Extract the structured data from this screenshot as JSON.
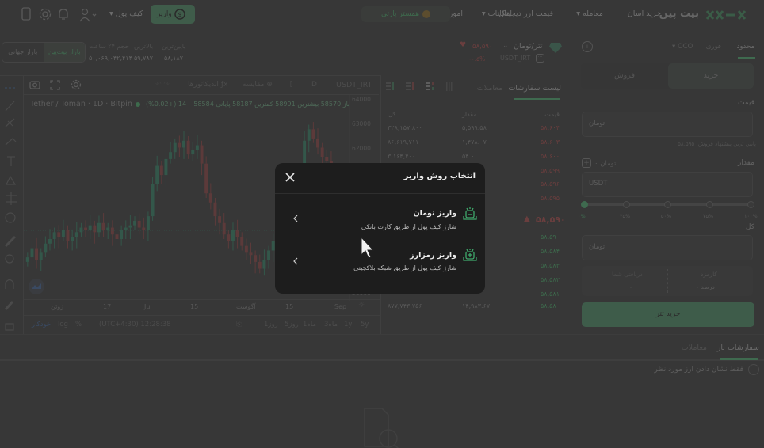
{
  "nav": {
    "logo_text": "بیت پین",
    "items": [
      {
        "label": "خرید آسان",
        "dropdown": false
      },
      {
        "label": "معامله",
        "dropdown": true
      },
      {
        "label": "قیمت ارز دیجیتال",
        "dropdown": false
      },
      {
        "label": "امکانات",
        "dropdown": true
      },
      {
        "label": "آموزش",
        "dropdown": true
      }
    ],
    "partner_label": "همستر پارتی",
    "deposit_label": "واریز",
    "wallet_label": "کیف پول",
    "icons": [
      "user-icon",
      "bell-icon",
      "gear-icon",
      "mobile-app-icon"
    ]
  },
  "ticker": {
    "pair_name": "تتر/تومان",
    "pair_symbol": "USDT_IRT",
    "last_price": "۵۸,۵۹۰",
    "change": "-۰.۵%",
    "stats": [
      {
        "label": "پایین‌ترین",
        "value": "۵۸,۱۸۷"
      },
      {
        "label": "بالاترین",
        "value": "۵۹,۷۸۷"
      },
      {
        "label": "حجم ۲۴ ساعت",
        "value": "۵۰,۰۶۹,۰۴۲,۴۱۴"
      }
    ],
    "market_toggle": [
      "بازار بیت‌پین",
      "بازار جهانی"
    ],
    "active_market": "بازار بیت‌پین"
  },
  "chart": {
    "symbol": "USDT_IRT",
    "interval": "D",
    "compare_label": "مقایسه",
    "indicators_label": "اندیکاتورها",
    "legend_title": "Tether / Toman · 1D · Bitpin",
    "legend_values": "باز 58570 بیشترین 58991 کمترین 58187 پایانی 58584 +14 (+0.02%)",
    "y_ticks": [
      "64000",
      "63000",
      "62000",
      "56000"
    ],
    "x_ticks": [
      "ژوئن",
      "17",
      "Jul",
      "15",
      "آگوست",
      "15",
      "Sep"
    ],
    "ranges": [
      "5y",
      "1y",
      "3ماه",
      "1ماه",
      "5روز",
      "1روز"
    ],
    "time_label": "(UTC+4:30) 12:28:38",
    "scale_options": [
      "%",
      "log",
      "خودکار"
    ]
  },
  "chart_data": {
    "type": "candlestick",
    "title": "Tether / Toman · 1D · Bitpin",
    "ylim": [
      55500,
      64500
    ],
    "y_ticks": [
      56000,
      62000,
      63000,
      64000
    ],
    "x_ticks": [
      "ژوئن",
      "17",
      "Jul",
      "15",
      "آگوست",
      "15",
      "Sep"
    ],
    "last_close": 58584,
    "open": 58570,
    "high": 58991,
    "low": 58187,
    "change": "+14 (+0.02%)"
  },
  "orderbook": {
    "tabs": [
      "لیست سفارشات",
      "معاملات"
    ],
    "active_tab": "لیست سفارشات",
    "headers": {
      "price": "قیمت",
      "amount": "مقدار",
      "total": "کل"
    },
    "asks": [
      {
        "price": "۵۸,۶۰۴",
        "amount": "۵,۵۹۹.۵۸",
        "total": "۳۲۸,۱۵۷,۸۰۰"
      },
      {
        "price": "۵۸,۶۰۳",
        "amount": "۱,۴۷۸.۰۷",
        "total": "۸۶,۶۱۹,۷۱۱"
      },
      {
        "price": "۵۸,۶۰۰",
        "amount": "۵۴.۰۰",
        "total": "۳,۱۶۴,۴۰۰"
      },
      {
        "price": "۵۸,۵۹۹",
        "amount": "",
        "total": ""
      },
      {
        "price": "۵۸,۵۹۶",
        "amount": "",
        "total": ""
      },
      {
        "price": "۵۸,۵۹۵",
        "amount": "",
        "total": ""
      }
    ],
    "mid_price": "۵۸,۵۹۰",
    "bids": [
      {
        "price": "۵۸,۵۹۰",
        "amount": "",
        "total": ""
      },
      {
        "price": "۵۸,۵۸۴",
        "amount": "",
        "total": ""
      },
      {
        "price": "۵۸,۵۸۳",
        "amount": "",
        "total": ""
      },
      {
        "price": "۵۸,۵۸۲",
        "amount": "",
        "total": ""
      },
      {
        "price": "۵۸,۵۸۱",
        "amount": "",
        "total": ""
      },
      {
        "price": "۵۸,۵۸۰",
        "amount": "۱۴,۹۸۳.۶۷",
        "total": "۸۷۷,۷۴۳,۷۵۶"
      }
    ]
  },
  "trade_form": {
    "order_types": [
      "محدود",
      "فوری",
      "OCO"
    ],
    "active_type": "محدود",
    "side_buttons": [
      "خرید",
      "فروش"
    ],
    "active_side": "خرید",
    "price_label": "قیمت",
    "price_placeholder": "تومان",
    "best_offer": "پایین ترین پیشنهاد فروش: ۵۸,۵۹۵",
    "amount_label": "مقدار",
    "amount_balance": "۰ تومان",
    "amount_placeholder": "USDT",
    "slider_value": 0,
    "slider_marks": [
      "۰%",
      "۲۵%",
      "۵۰%",
      "۷۵%",
      "۱۰۰%"
    ],
    "total_label": "کل",
    "total_placeholder": "تومان",
    "fee_label": "کارمزد",
    "fee_value": "۰ درصد",
    "receive_label": "دریافتی شما",
    "receive_value": "۰",
    "submit_label": "خرید تتر"
  },
  "bottom": {
    "tabs": [
      "سفارشات باز",
      "معاملات"
    ],
    "active_tab": "سفارشات باز",
    "filter_label": "فقط نشان دادن ارز مورد نظر"
  },
  "modal": {
    "title": "انتخاب روش واریز",
    "options": [
      {
        "title": "واریز تومان",
        "subtitle": "شارژ کیف پول از طریق کارت بانکی",
        "icon": "toman-deposit-icon"
      },
      {
        "title": "واریز رمزارز",
        "subtitle": "شارژ کیف پول از طریق شبکه بلاکچینی",
        "icon": "crypto-deposit-icon"
      }
    ]
  },
  "colors": {
    "accent": "#3f6a4f",
    "up": "#3d6a4c",
    "down": "#6a3e3e",
    "modal_bg": "#1d1d1d"
  }
}
